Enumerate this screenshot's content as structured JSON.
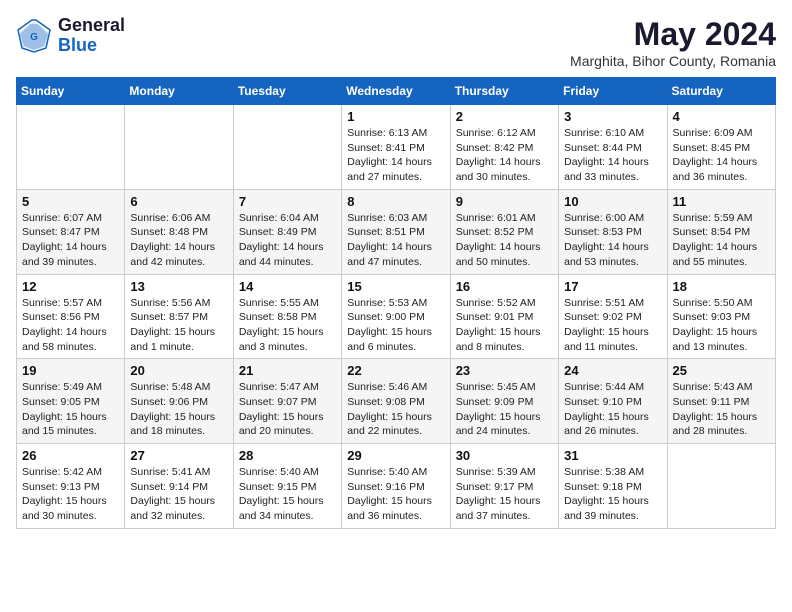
{
  "logo": {
    "general": "General",
    "blue": "Blue"
  },
  "title": {
    "month_year": "May 2024",
    "location": "Marghita, Bihor County, Romania"
  },
  "weekdays": [
    "Sunday",
    "Monday",
    "Tuesday",
    "Wednesday",
    "Thursday",
    "Friday",
    "Saturday"
  ],
  "weeks": [
    [
      {
        "day": null,
        "info": null
      },
      {
        "day": null,
        "info": null
      },
      {
        "day": null,
        "info": null
      },
      {
        "day": "1",
        "info": "Sunrise: 6:13 AM\nSunset: 8:41 PM\nDaylight: 14 hours\nand 27 minutes."
      },
      {
        "day": "2",
        "info": "Sunrise: 6:12 AM\nSunset: 8:42 PM\nDaylight: 14 hours\nand 30 minutes."
      },
      {
        "day": "3",
        "info": "Sunrise: 6:10 AM\nSunset: 8:44 PM\nDaylight: 14 hours\nand 33 minutes."
      },
      {
        "day": "4",
        "info": "Sunrise: 6:09 AM\nSunset: 8:45 PM\nDaylight: 14 hours\nand 36 minutes."
      }
    ],
    [
      {
        "day": "5",
        "info": "Sunrise: 6:07 AM\nSunset: 8:47 PM\nDaylight: 14 hours\nand 39 minutes."
      },
      {
        "day": "6",
        "info": "Sunrise: 6:06 AM\nSunset: 8:48 PM\nDaylight: 14 hours\nand 42 minutes."
      },
      {
        "day": "7",
        "info": "Sunrise: 6:04 AM\nSunset: 8:49 PM\nDaylight: 14 hours\nand 44 minutes."
      },
      {
        "day": "8",
        "info": "Sunrise: 6:03 AM\nSunset: 8:51 PM\nDaylight: 14 hours\nand 47 minutes."
      },
      {
        "day": "9",
        "info": "Sunrise: 6:01 AM\nSunset: 8:52 PM\nDaylight: 14 hours\nand 50 minutes."
      },
      {
        "day": "10",
        "info": "Sunrise: 6:00 AM\nSunset: 8:53 PM\nDaylight: 14 hours\nand 53 minutes."
      },
      {
        "day": "11",
        "info": "Sunrise: 5:59 AM\nSunset: 8:54 PM\nDaylight: 14 hours\nand 55 minutes."
      }
    ],
    [
      {
        "day": "12",
        "info": "Sunrise: 5:57 AM\nSunset: 8:56 PM\nDaylight: 14 hours\nand 58 minutes."
      },
      {
        "day": "13",
        "info": "Sunrise: 5:56 AM\nSunset: 8:57 PM\nDaylight: 15 hours\nand 1 minute."
      },
      {
        "day": "14",
        "info": "Sunrise: 5:55 AM\nSunset: 8:58 PM\nDaylight: 15 hours\nand 3 minutes."
      },
      {
        "day": "15",
        "info": "Sunrise: 5:53 AM\nSunset: 9:00 PM\nDaylight: 15 hours\nand 6 minutes."
      },
      {
        "day": "16",
        "info": "Sunrise: 5:52 AM\nSunset: 9:01 PM\nDaylight: 15 hours\nand 8 minutes."
      },
      {
        "day": "17",
        "info": "Sunrise: 5:51 AM\nSunset: 9:02 PM\nDaylight: 15 hours\nand 11 minutes."
      },
      {
        "day": "18",
        "info": "Sunrise: 5:50 AM\nSunset: 9:03 PM\nDaylight: 15 hours\nand 13 minutes."
      }
    ],
    [
      {
        "day": "19",
        "info": "Sunrise: 5:49 AM\nSunset: 9:05 PM\nDaylight: 15 hours\nand 15 minutes."
      },
      {
        "day": "20",
        "info": "Sunrise: 5:48 AM\nSunset: 9:06 PM\nDaylight: 15 hours\nand 18 minutes."
      },
      {
        "day": "21",
        "info": "Sunrise: 5:47 AM\nSunset: 9:07 PM\nDaylight: 15 hours\nand 20 minutes."
      },
      {
        "day": "22",
        "info": "Sunrise: 5:46 AM\nSunset: 9:08 PM\nDaylight: 15 hours\nand 22 minutes."
      },
      {
        "day": "23",
        "info": "Sunrise: 5:45 AM\nSunset: 9:09 PM\nDaylight: 15 hours\nand 24 minutes."
      },
      {
        "day": "24",
        "info": "Sunrise: 5:44 AM\nSunset: 9:10 PM\nDaylight: 15 hours\nand 26 minutes."
      },
      {
        "day": "25",
        "info": "Sunrise: 5:43 AM\nSunset: 9:11 PM\nDaylight: 15 hours\nand 28 minutes."
      }
    ],
    [
      {
        "day": "26",
        "info": "Sunrise: 5:42 AM\nSunset: 9:13 PM\nDaylight: 15 hours\nand 30 minutes."
      },
      {
        "day": "27",
        "info": "Sunrise: 5:41 AM\nSunset: 9:14 PM\nDaylight: 15 hours\nand 32 minutes."
      },
      {
        "day": "28",
        "info": "Sunrise: 5:40 AM\nSunset: 9:15 PM\nDaylight: 15 hours\nand 34 minutes."
      },
      {
        "day": "29",
        "info": "Sunrise: 5:40 AM\nSunset: 9:16 PM\nDaylight: 15 hours\nand 36 minutes."
      },
      {
        "day": "30",
        "info": "Sunrise: 5:39 AM\nSunset: 9:17 PM\nDaylight: 15 hours\nand 37 minutes."
      },
      {
        "day": "31",
        "info": "Sunrise: 5:38 AM\nSunset: 9:18 PM\nDaylight: 15 hours\nand 39 minutes."
      },
      {
        "day": null,
        "info": null
      }
    ]
  ]
}
